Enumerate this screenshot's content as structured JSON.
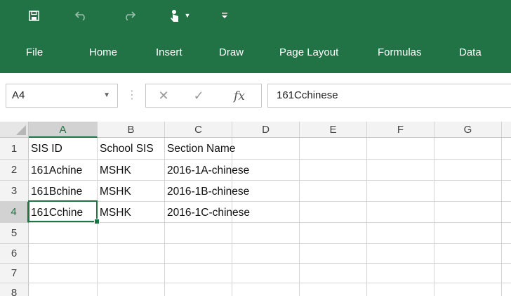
{
  "quick_access": {
    "save_icon": "save-icon",
    "undo_icon": "undo-icon",
    "redo_icon": "redo-icon",
    "touch_mode_icon": "touch-mode-icon",
    "customize_icon": "customize-qat-icon"
  },
  "ribbon": {
    "tabs": [
      "File",
      "Home",
      "Insert",
      "Draw",
      "Page Layout",
      "Formulas",
      "Data"
    ],
    "accent_color": "#217346"
  },
  "formula_bar": {
    "name_box": "A4",
    "fx_label": "fx",
    "formula_value": "161Cchinese"
  },
  "sheet": {
    "columns": [
      "A",
      "B",
      "C",
      "D",
      "E",
      "F",
      "G"
    ],
    "rows": [
      "1",
      "2",
      "3",
      "4",
      "5",
      "6",
      "7",
      "8"
    ],
    "active_cell": "A4",
    "cells": {
      "A1": "SIS ID",
      "B1": "School SIS",
      "C1": "Section Name",
      "A2": "161Achine",
      "B2": "MSHK",
      "C2": "2016-1A-chinese",
      "A3": "161Bchine",
      "B3": "MSHK",
      "C3": "2016-1B-chinese",
      "A4": "161Cchine",
      "B4": "MSHK",
      "C4": "2016-1C-chinese"
    }
  }
}
